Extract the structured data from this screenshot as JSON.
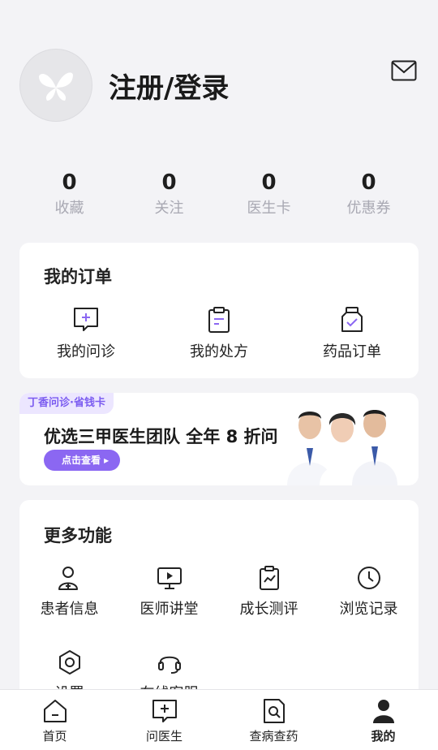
{
  "profile": {
    "login_label": "注册/登录"
  },
  "stats": [
    {
      "value": "0",
      "label": "收藏"
    },
    {
      "value": "0",
      "label": "关注"
    },
    {
      "value": "0",
      "label": "医生卡"
    },
    {
      "value": "0",
      "label": "优惠券"
    }
  ],
  "orders": {
    "title": "我的订单",
    "items": [
      {
        "label": "我的问诊",
        "icon": "consult-chat-icon"
      },
      {
        "label": "我的处方",
        "icon": "prescription-clipboard-icon"
      },
      {
        "label": "药品订单",
        "icon": "medicine-bottle-icon"
      }
    ]
  },
  "banner": {
    "tag": "丁香问诊·省钱卡",
    "title": "优选三甲医生团队 全年 8 折问",
    "button": "点击查看 ▸"
  },
  "more": {
    "title": "更多功能",
    "items": [
      {
        "label": "患者信息",
        "icon": "patient-add-icon"
      },
      {
        "label": "医师讲堂",
        "icon": "video-lecture-icon"
      },
      {
        "label": "成长测评",
        "icon": "growth-chart-icon"
      },
      {
        "label": "浏览记录",
        "icon": "clock-history-icon"
      },
      {
        "label": "设置",
        "icon": "settings-hex-icon"
      },
      {
        "label": "在线客服",
        "icon": "headset-icon"
      }
    ]
  },
  "tabbar": [
    {
      "label": "首页",
      "icon": "home-icon"
    },
    {
      "label": "问医生",
      "icon": "ask-doctor-icon"
    },
    {
      "label": "查病查药",
      "icon": "search-document-icon"
    },
    {
      "label": "我的",
      "icon": "user-icon",
      "active": true
    }
  ],
  "colors": {
    "accent": "#8b67f2",
    "muted": "#a9a9b3",
    "background": "#f3f3f6"
  }
}
